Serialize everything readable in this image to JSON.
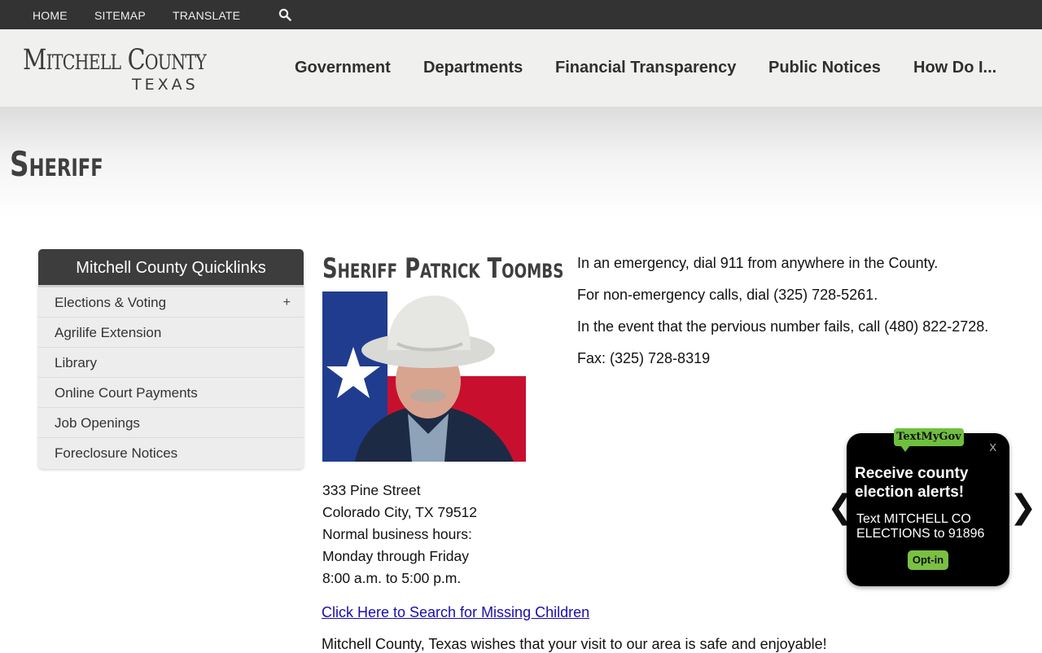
{
  "topbar": {
    "home": "HOME",
    "sitemap": "SITEMAP",
    "translate": "TRANSLATE",
    "search_icon": "search-icon"
  },
  "logo": {
    "line1": "Mitchell County",
    "line2": "TEXAS"
  },
  "nav": {
    "government": "Government",
    "departments": "Departments",
    "financial": "Financial Transparency",
    "notices": "Public Notices",
    "howdoi": "How Do I..."
  },
  "page": {
    "title": "Sheriff"
  },
  "quicklinks": {
    "heading": "Mitchell County Quicklinks",
    "items": [
      {
        "label": "Elections & Voting",
        "expand": "+"
      },
      {
        "label": "Agrilife Extension"
      },
      {
        "label": "Library"
      },
      {
        "label": "Online Court Payments"
      },
      {
        "label": "Job Openings"
      },
      {
        "label": "Foreclosure Notices"
      }
    ]
  },
  "sheriff": {
    "name": "Sheriff Patrick Toombs",
    "address": [
      "333 Pine Street",
      "Colorado City, TX 79512",
      "Normal business hours:",
      "Monday through Friday",
      "8:00 a.m. to 5:00 p.m."
    ],
    "missing_link": "Click Here to Search for Missing Children",
    "welcome": "Mitchell County, Texas wishes that your visit to our area is safe and enjoyable!"
  },
  "contact": [
    "In an emergency, dial 911 from anywhere in the County.",
    "For non-emergency calls, dial (325) 728-5261.",
    "In the event that the pervious number fails, call (480) 822-2728.",
    "Fax: (325) 728-8319"
  ],
  "textmygov": {
    "badge": "TextMyGov",
    "close": "X",
    "heading": "Receive county election alerts!",
    "body": "Text MITCHELL CO ELECTIONS to 91896",
    "optin": "Opt-in",
    "prev": "❮",
    "next": "❯"
  },
  "colors": {
    "topbar": "#333333",
    "header": "#f0f0ee",
    "link": "#1a0dab",
    "widget_accent": "#7ac143"
  }
}
